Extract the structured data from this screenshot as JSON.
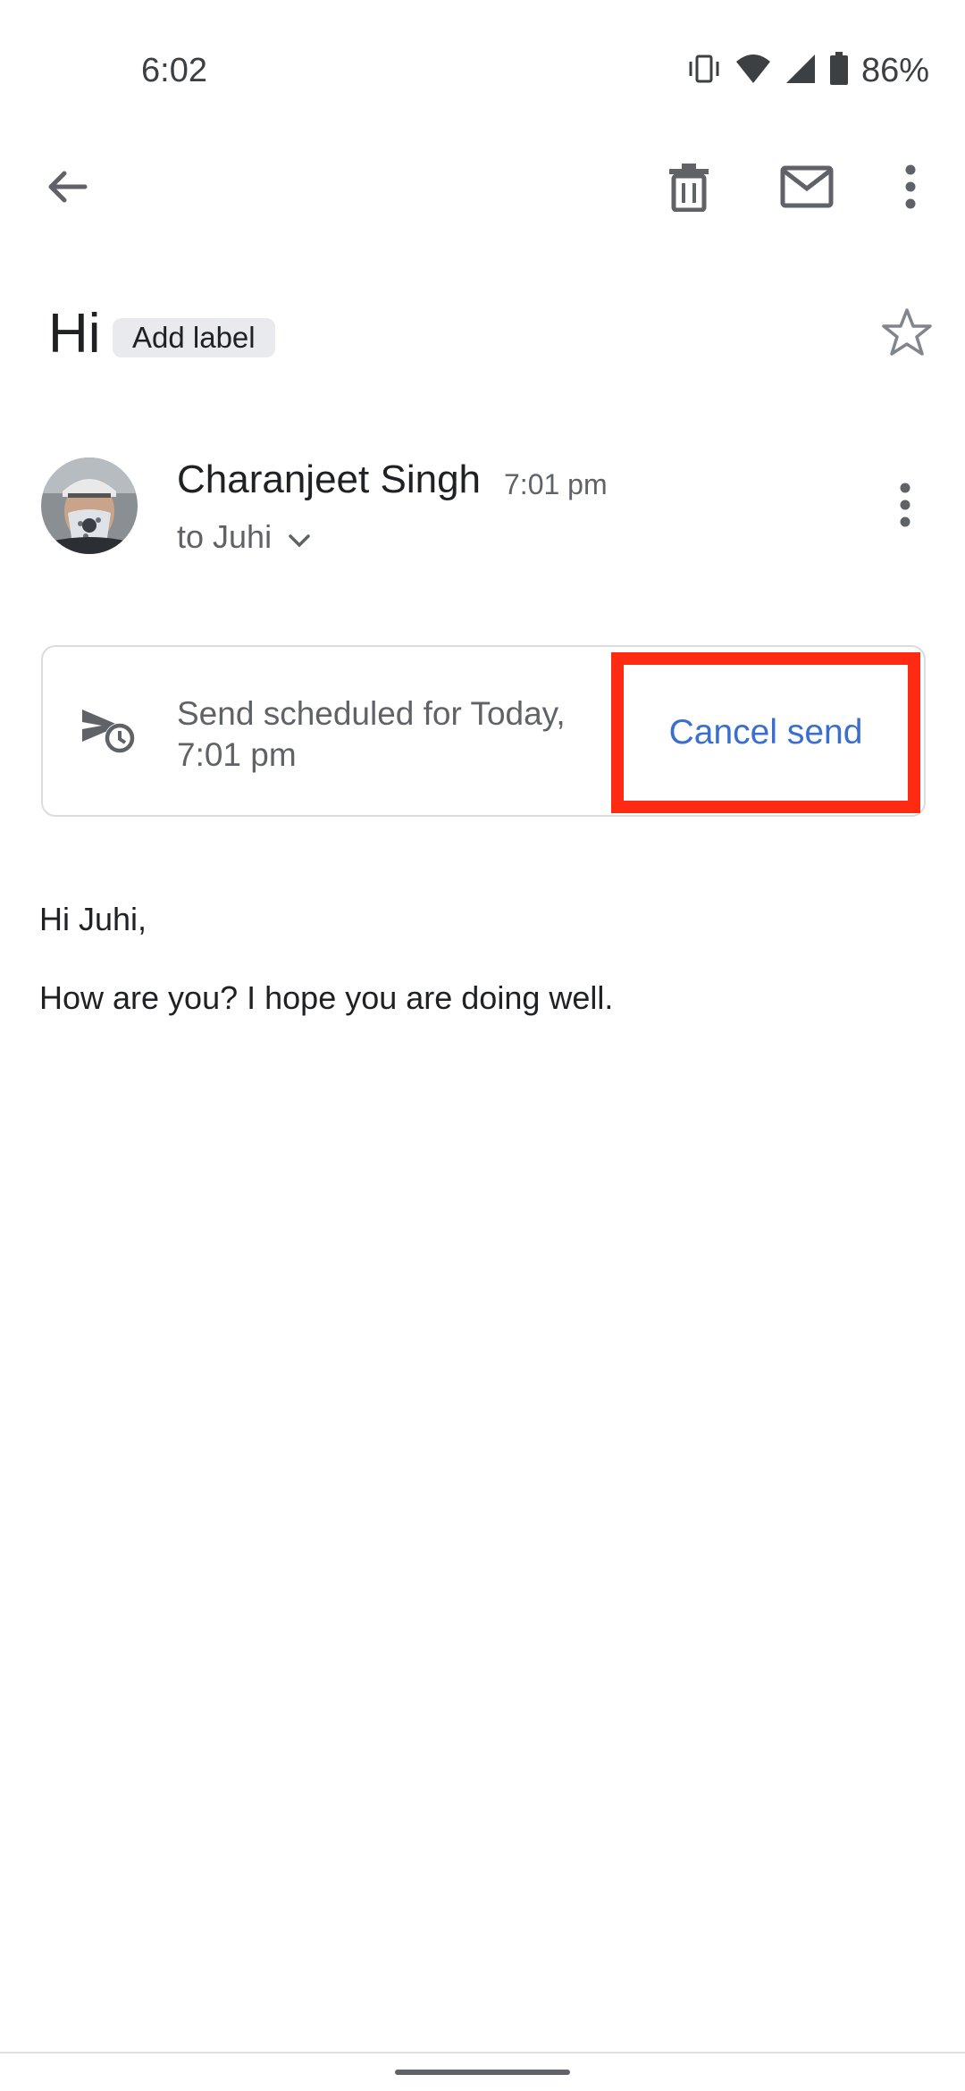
{
  "status_bar": {
    "time": "6:02",
    "battery_percent": "86%",
    "icons": [
      "vibrate-icon",
      "wifi-icon",
      "signal-icon",
      "battery-icon"
    ]
  },
  "toolbar": {
    "icons": [
      "back-arrow-icon",
      "delete-icon",
      "mark-unread-icon",
      "more-vert-icon"
    ]
  },
  "email": {
    "subject": "Hi",
    "label_button": "Add label",
    "sender_name": "Charanjeet Singh",
    "sent_time": "7:01 pm",
    "recipient": "to Juhi",
    "schedule": {
      "message": "Send scheduled for Today, 7:01 pm",
      "cancel_label": "Cancel send"
    },
    "body": {
      "greeting": "Hi Juhi,",
      "line1": "How are you? I hope you are doing well."
    }
  },
  "colors": {
    "accent_link": "#3a6fd0",
    "highlight_box": "#ff2a12",
    "secondary_text": "#5f6368"
  }
}
